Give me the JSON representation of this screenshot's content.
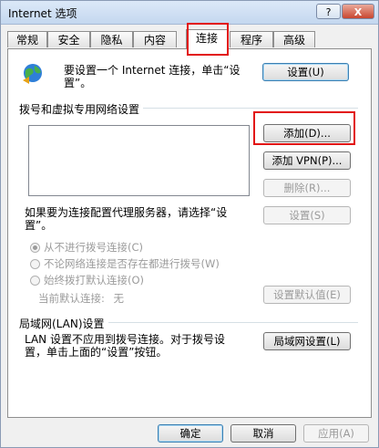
{
  "window": {
    "title": "Internet 选项",
    "help_label": "?",
    "close_label": "X"
  },
  "tabs": [
    {
      "label": "常规"
    },
    {
      "label": "安全"
    },
    {
      "label": "隐私"
    },
    {
      "label": "内容"
    },
    {
      "label": "连接",
      "active": true
    },
    {
      "label": "程序"
    },
    {
      "label": "高级"
    }
  ],
  "setup": {
    "text_line1": "要设置一个 Internet 连接，单击“设",
    "text_line2": "置”。",
    "button": "设置(U)",
    "icon": "globe-network-icon"
  },
  "dialup": {
    "group_label": "拨号和虚拟专用网络设置",
    "add_button": "添加(D)...",
    "add_vpn_button": "添加 VPN(P)...",
    "remove_button": "删除(R)...",
    "proxy_text_line1": "如果要为连接配置代理服务器，请选择“设",
    "proxy_text_line2": "置”。",
    "settings_button": "设置(S)",
    "options": [
      {
        "label": "从不进行拨号连接(C)",
        "checked": true
      },
      {
        "label": "不论网络连接是否存在都进行拨号(W)",
        "checked": false
      },
      {
        "label": "始终拨打默认连接(O)",
        "checked": false
      }
    ],
    "current_default_label": "当前默认连接:",
    "current_default_value": "无",
    "set_default_button": "设置默认值(E)"
  },
  "lan": {
    "group_label": "局域网(LAN)设置",
    "text_line1": "LAN 设置不应用到拨号连接。对于拨号设",
    "text_line2": "置，单击上面的“设置”按钮。",
    "button": "局域网设置(L)"
  },
  "footer": {
    "ok": "确定",
    "cancel": "取消",
    "apply": "应用(A)"
  },
  "colors": {
    "highlight": "#e21212"
  }
}
